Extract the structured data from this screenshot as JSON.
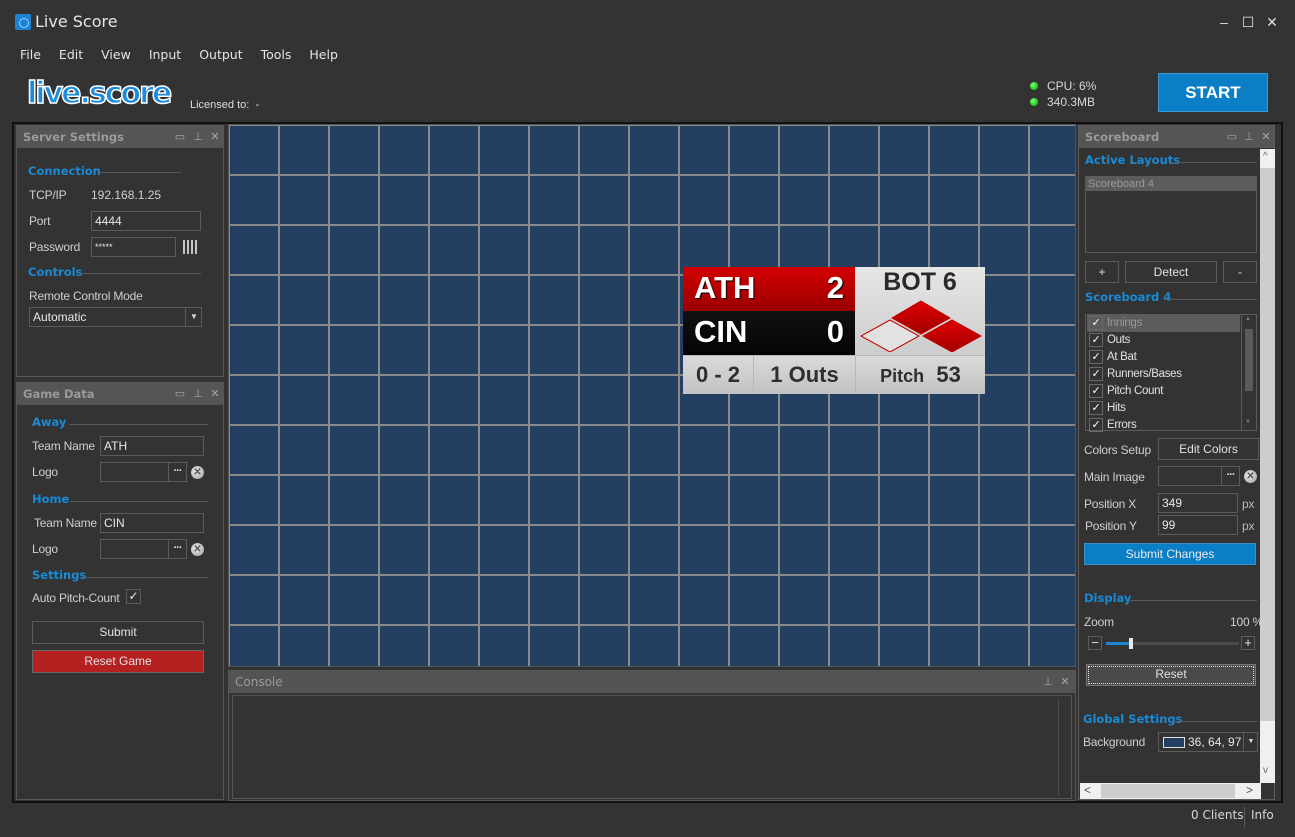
{
  "window": {
    "title": "Live Score",
    "minimize_glyph": "‒",
    "maximize_glyph": "☐",
    "close_glyph": "✕"
  },
  "menu": [
    "File",
    "Edit",
    "View",
    "Input",
    "Output",
    "Tools",
    "Help"
  ],
  "header": {
    "logo_text": "live.score",
    "licensed_label": "Licensed to:",
    "licensed_value": "-",
    "cpu": "CPU: 6%",
    "memory": "340.3MB",
    "start_label": "START",
    "status_color": "#0aaa0a",
    "accent_color": "#0a7fc6"
  },
  "server_settings": {
    "title": "Server Settings",
    "connection_heading": "Connection",
    "tcpip_label": "TCP/IP",
    "tcpip_value": "192.168.1.25",
    "port_label": "Port",
    "port_value": "4444",
    "password_label": "Password",
    "password_value": "*****",
    "controls_heading": "Controls",
    "remote_mode_label": "Remote Control Mode",
    "remote_mode_value": "Automatic"
  },
  "game_data": {
    "title": "Game Data",
    "away_heading": "Away",
    "away_team_label": "Team Name",
    "away_team_value": "ATH",
    "away_logo_label": "Logo",
    "home_heading": "Home",
    "home_team_label": "Team Name",
    "home_team_value": "CIN",
    "home_logo_label": "Logo",
    "settings_heading": "Settings",
    "auto_pitch_label": "Auto Pitch-Count",
    "auto_pitch_checked": true,
    "submit_label": "Submit",
    "reset_label": "Reset Game",
    "reset_color": "#b52020"
  },
  "scoreboard_graphic": {
    "away_team": "ATH",
    "away_score": "2",
    "home_team": "CIN",
    "home_score": "0",
    "inning": "BOT 6",
    "count": "0 - 2",
    "outs": "1 Outs",
    "pitch_label": "Pitch",
    "pitch_value": "53",
    "bases": {
      "first": true,
      "second": true,
      "third": false
    }
  },
  "canvas": {
    "background_rgb": "36, 64, 97",
    "background_hex": "#244061"
  },
  "console": {
    "title": "Console"
  },
  "scoreboard_panel": {
    "title": "Scoreboard",
    "active_layouts_heading": "Active Layouts",
    "layouts": [
      "Scoreboard 4"
    ],
    "add_label": "+",
    "detect_label": "Detect",
    "remove_label": "-",
    "layout_heading": "Scoreboard 4",
    "elements": [
      {
        "label": "Innings",
        "checked": true,
        "selected": true
      },
      {
        "label": "Outs",
        "checked": true
      },
      {
        "label": "At Bat",
        "checked": true
      },
      {
        "label": "Runners/Bases",
        "checked": true
      },
      {
        "label": "Pitch Count",
        "checked": true
      },
      {
        "label": "Hits",
        "checked": true
      },
      {
        "label": "Errors",
        "checked": true
      }
    ],
    "colors_setup_label": "Colors Setup",
    "edit_colors_label": "Edit Colors",
    "main_image_label": "Main Image",
    "position_x_label": "Position X",
    "position_x_value": "349",
    "position_y_label": "Position Y",
    "position_y_value": "99",
    "px_unit": "px",
    "submit_changes_label": "Submit Changes",
    "display_heading": "Display",
    "zoom_label": "Zoom",
    "zoom_value": "100 %",
    "zoom_percent": 100,
    "zoom_slider_fraction": 0.17,
    "reset_label": "Reset",
    "global_heading": "Global Settings",
    "background_label": "Background",
    "background_value": "36, 64, 97"
  },
  "statusbar": {
    "clients": "0 Clients",
    "info": "Info"
  }
}
